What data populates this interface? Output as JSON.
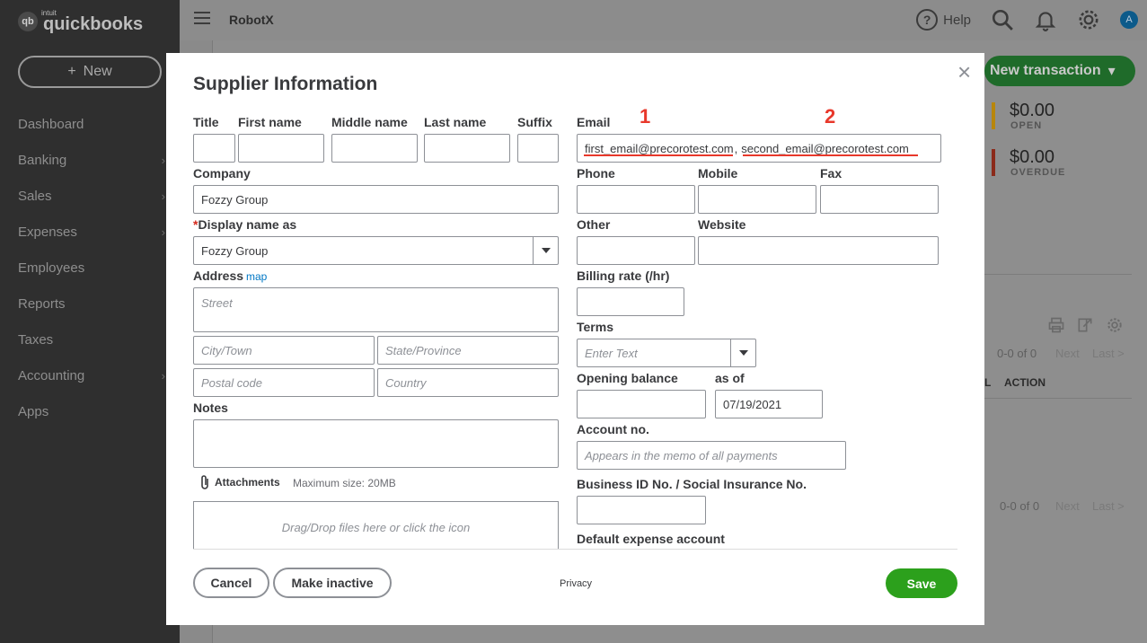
{
  "app": {
    "brand_small": "intuit",
    "brand": "quickbooks",
    "logo_mark": "qb",
    "company": "RobotX",
    "new_button": "New",
    "help_label": "Help",
    "avatar_letter": "A",
    "nav": [
      {
        "label": "Dashboard",
        "chevron": false
      },
      {
        "label": "Banking",
        "chevron": true
      },
      {
        "label": "Sales",
        "chevron": true
      },
      {
        "label": "Expenses",
        "chevron": true
      },
      {
        "label": "Employees",
        "chevron": false
      },
      {
        "label": "Reports",
        "chevron": false
      },
      {
        "label": "Taxes",
        "chevron": false
      },
      {
        "label": "Accounting",
        "chevron": true
      },
      {
        "label": "Apps",
        "chevron": false
      }
    ],
    "new_transaction": "New transaction",
    "open_amount": "$0.00",
    "open_label": "OPEN",
    "overdue_amount": "$0.00",
    "overdue_label": "OVERDUE",
    "pager_count": "0-0 of 0",
    "pager_next": "Next",
    "pager_last": "Last >",
    "col_l": "L",
    "col_action": "ACTION",
    "colors": {
      "open_bar": "#b8860b",
      "overdue_bar": "#8b2a1a",
      "save": "#2ca01c",
      "annotation": "#e8382b"
    }
  },
  "modal": {
    "title": "Supplier Information",
    "labels": {
      "title": "Title",
      "first_name": "First name",
      "middle_name": "Middle name",
      "last_name": "Last name",
      "suffix": "Suffix",
      "email": "Email",
      "company": "Company",
      "display_name": "Display name as",
      "address": "Address",
      "map": "map",
      "phone": "Phone",
      "mobile": "Mobile",
      "fax": "Fax",
      "other": "Other",
      "website": "Website",
      "billing_rate": "Billing rate (/hr)",
      "terms": "Terms",
      "opening_balance": "Opening balance",
      "as_of": "as of",
      "account_no": "Account no.",
      "business_id": "Business ID No. / Social Insurance No.",
      "default_expense": "Default expense account",
      "notes": "Notes",
      "attachments": "Attachments",
      "max_size": "Maximum size: 20MB"
    },
    "values": {
      "email_1": "first_email@precorotest.com",
      "email_sep": ",",
      "email_2": "second_email@precorotest.com",
      "company": "Fozzy Group",
      "display_name": "Fozzy Group",
      "as_of_date": "07/19/2021"
    },
    "placeholders": {
      "street": "Street",
      "city": "City/Town",
      "state": "State/Province",
      "postal": "Postal code",
      "country": "Country",
      "terms": "Enter Text",
      "account_no": "Appears in the memo of all payments",
      "dropzone": "Drag/Drop files here or click the icon"
    },
    "annotations": {
      "one": "1",
      "two": "2"
    },
    "buttons": {
      "cancel": "Cancel",
      "make_inactive": "Make inactive",
      "privacy": "Privacy",
      "save": "Save",
      "close": "×"
    }
  }
}
